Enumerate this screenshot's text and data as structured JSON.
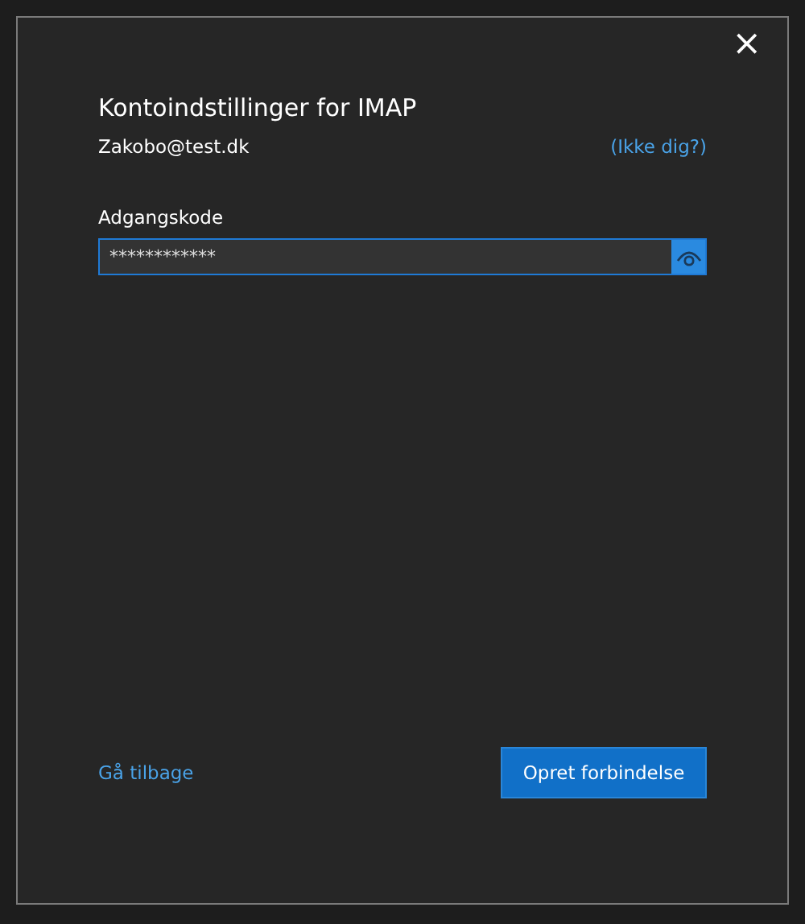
{
  "dialog": {
    "close": "×",
    "title": "Kontoindstillinger for IMAP",
    "account": "Zakobo@test.dk",
    "not_you_link": "(Ikke dig?)"
  },
  "password": {
    "label": "Adgangskode",
    "value": "************"
  },
  "back_link": "Gå tilbage",
  "connect_button": "Opret forbindelse"
}
